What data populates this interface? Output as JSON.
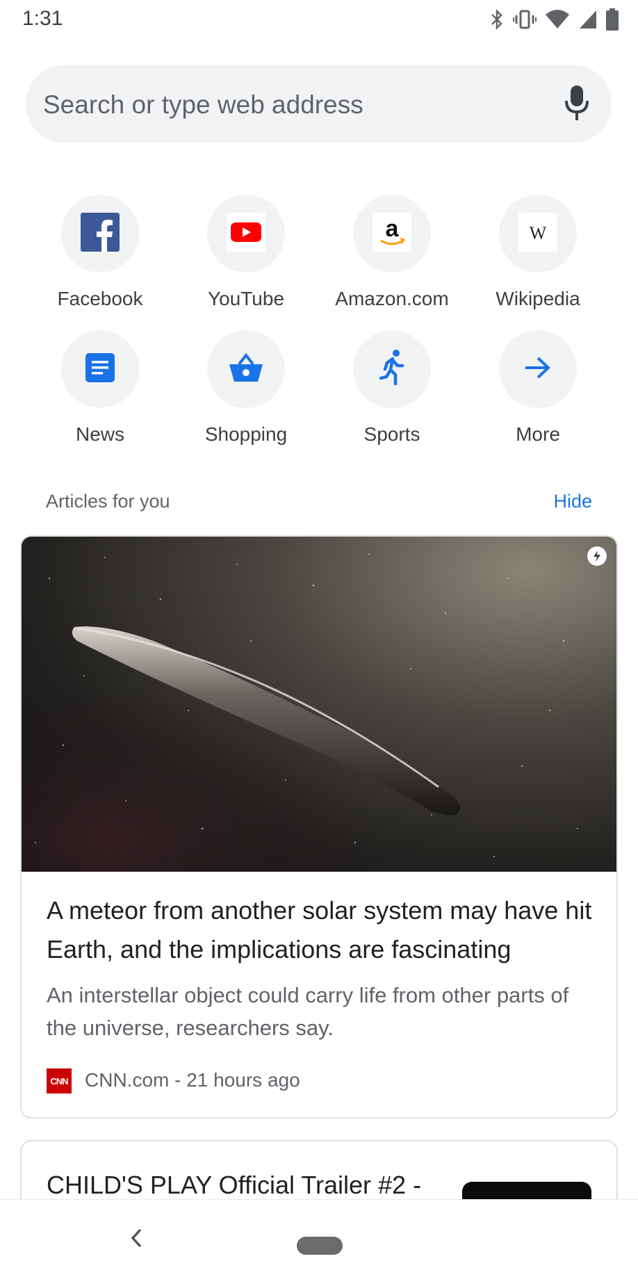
{
  "status_bar": {
    "time": "1:31",
    "icons": [
      "bluetooth-icon",
      "vibrate-icon",
      "wifi-icon",
      "signal-icon",
      "battery-icon"
    ]
  },
  "search": {
    "placeholder": "Search or type web address",
    "icon": "mic-icon"
  },
  "shortcuts": [
    {
      "label": "Facebook",
      "icon": "facebook-icon"
    },
    {
      "label": "YouTube",
      "icon": "youtube-icon"
    },
    {
      "label": "Amazon.com",
      "icon": "amazon-icon"
    },
    {
      "label": "Wikipedia",
      "icon": "wikipedia-icon"
    },
    {
      "label": "News",
      "icon": "news-icon"
    },
    {
      "label": "Shopping",
      "icon": "shopping-basket-icon"
    },
    {
      "label": "Sports",
      "icon": "running-icon"
    },
    {
      "label": "More",
      "icon": "arrow-right-icon"
    }
  ],
  "articles": {
    "header": "Articles for you",
    "hide_label": "Hide",
    "items": [
      {
        "title": "A meteor from another solar system may have hit Earth, and the implications are fascinating",
        "summary": "An interstellar object could carry life from other parts of the universe, researchers say.",
        "source": "CNN.com - 21 hours ago",
        "source_logo_text": "CNN"
      },
      {
        "title": "CHILD'S PLAY Official Trailer #2 -"
      }
    ]
  },
  "colors": {
    "accent": "#1a73e8",
    "tile_bg": "#f1f3f4",
    "facebook": "#3b5998",
    "youtube": "#ff0000",
    "cnn": "#cc0000"
  }
}
